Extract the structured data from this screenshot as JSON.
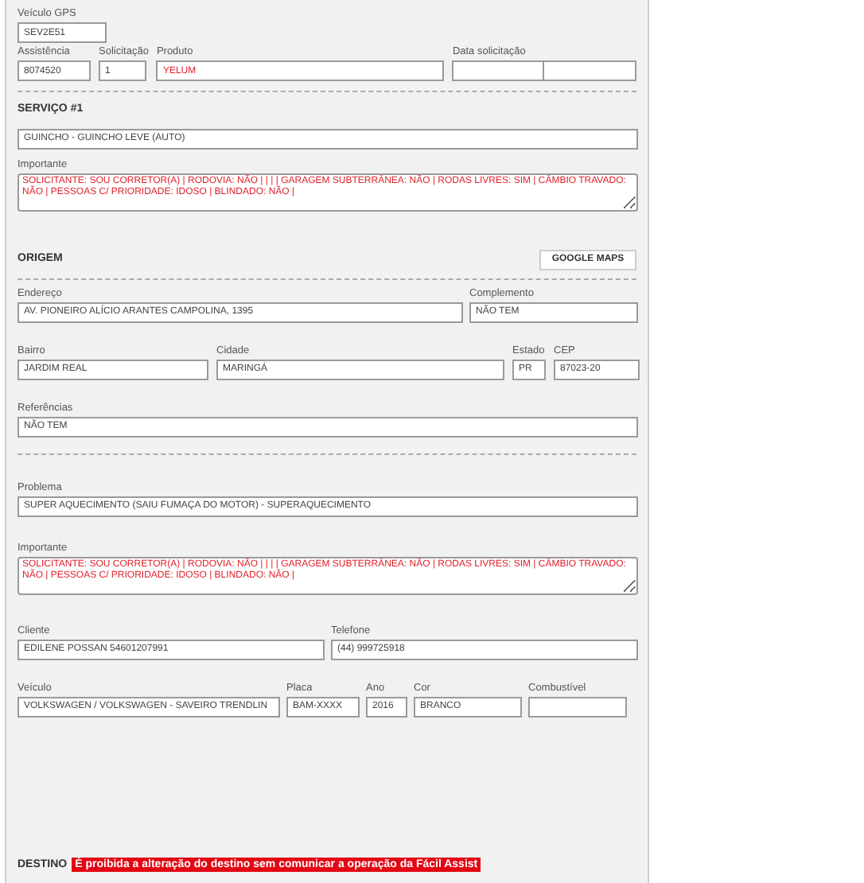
{
  "vehicle_gps": {
    "label": "Veículo GPS",
    "value": "SEV2E51"
  },
  "request": [
    {
      "label": "Assistência",
      "value": "8074520",
      "alert": false
    },
    {
      "label": "Solicitação",
      "value": "1",
      "alert": false
    },
    {
      "label": "Produto",
      "value": "YELUM",
      "alert": true
    },
    {
      "label": "Data solicitação"
    }
  ],
  "service": {
    "heading": "SERVIÇO #1",
    "value": "GUINCHO - GUINCHO LEVE (AUTO)",
    "important_label": "Importante",
    "important": "SOLICITANTE: SOU CORRETOR(A) | RODOVIA: NÃO | | | | GARAGEM SUBTERRÂNEA: NÃO | RODAS LIVRES: SIM | CÂMBIO TRAVADO: NÃO | PESSOAS C/ PRIORIDADE: IDOSO | BLINDADO: NÃO |"
  },
  "origin": {
    "heading": "ORIGEM",
    "map_button": "GOOGLE MAPS",
    "address_row": [
      {
        "label": "Endereço",
        "value": "AV. PIONEIRO ALÍCIO ARANTES CAMPOLINA, 1395"
      },
      {
        "label": "Complemento",
        "value": "NÃO TEM"
      }
    ],
    "city_row": [
      {
        "label": "Bairro",
        "value": "JARDIM REAL"
      },
      {
        "label": "Cidade",
        "value": "MARINGÁ"
      },
      {
        "label": "Estado",
        "value": "PR"
      },
      {
        "label": "CEP",
        "value": "87023-20"
      }
    ],
    "references": {
      "label": "Referências",
      "value": "NÃO TEM"
    }
  },
  "problem": {
    "label": "Problema",
    "value": "SUPER AQUECIMENTO (SAIU FUMAÇA DO MOTOR) - SUPERAQUECIMENTO",
    "important_label": "Importante",
    "important": "SOLICITANTE: SOU CORRETOR(A) | RODOVIA: NÃO | | | | GARAGEM SUBTERRÂNEA: NÃO | RODAS LIVRES: SIM | CÂMBIO TRAVADO: NÃO | PESSOAS C/ PRIORIDADE: IDOSO | BLINDADO: NÃO |"
  },
  "client_row": [
    {
      "label": "Cliente",
      "value": "EDILENE POSSAN 54601207991"
    },
    {
      "label": "Telefone",
      "value": "(44) 999725918"
    }
  ],
  "vehicle_row": [
    {
      "label": "Veículo",
      "value": "VOLKSWAGEN / VOLKSWAGEN - SAVEIRO  TRENDLIN"
    },
    {
      "label": "Placa",
      "value": "BAM-XXXX"
    },
    {
      "label": "Ano",
      "value": "2016"
    },
    {
      "label": "Cor",
      "value": "BRANCO"
    },
    {
      "label": "Combustível"
    }
  ],
  "destination": {
    "heading": "DESTINO",
    "warning": "É proibida a alteração do destino sem comunicar a operação da Fácil Assist"
  }
}
